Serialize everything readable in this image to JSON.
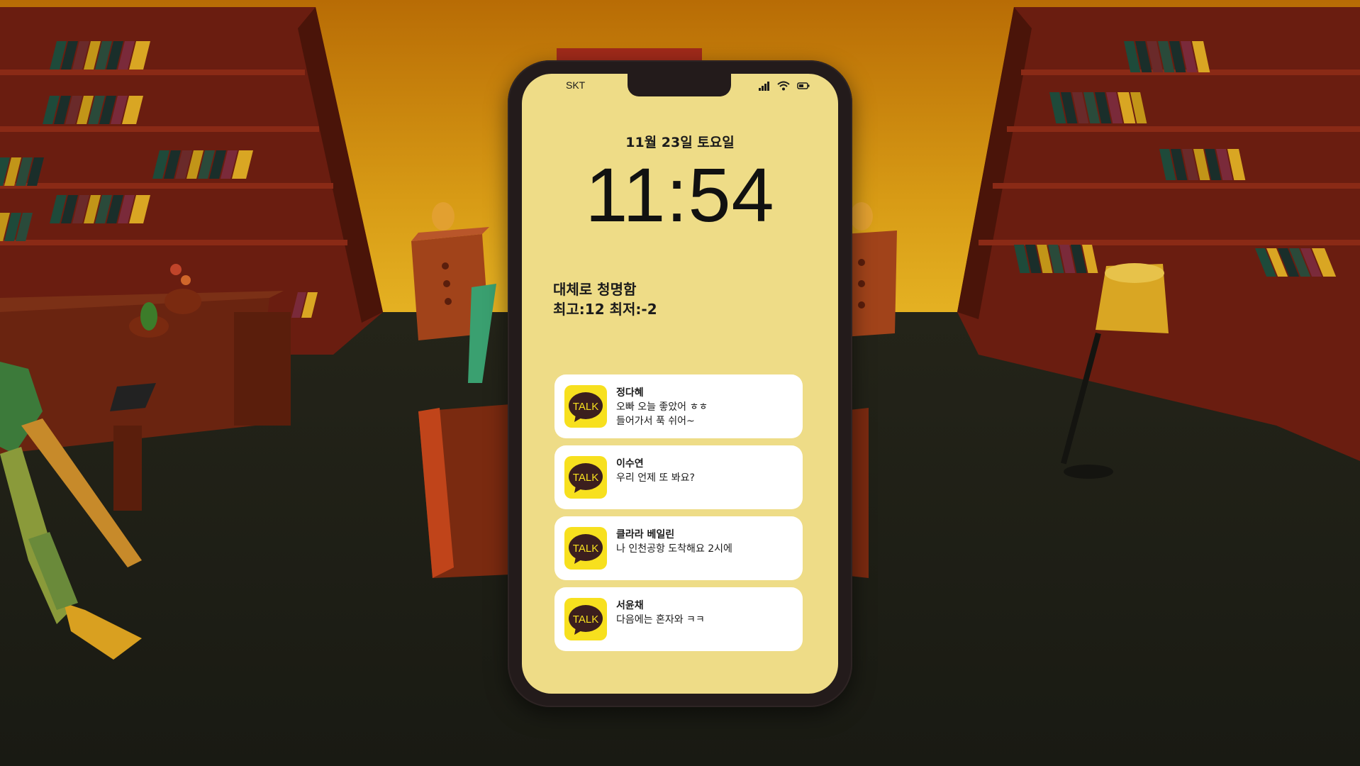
{
  "phone": {
    "carrier": "SKT",
    "date": "11월 23일 토요일",
    "time": "11:54",
    "weather": {
      "condition": "대체로 청명함",
      "temps": "최고:12 최저:-2"
    },
    "icons": [
      "signal-icon",
      "wifi-icon",
      "battery-icon"
    ],
    "notifications": [
      {
        "app_icon": "TALK",
        "sender": "정다혜",
        "lines": [
          "오빠 오늘 좋았어 ㅎㅎ",
          "들어가서 푹 쉬어~"
        ]
      },
      {
        "app_icon": "TALK",
        "sender": "이수연",
        "lines": [
          "우리 언제 또 봐요?"
        ]
      },
      {
        "app_icon": "TALK",
        "sender": "클라라 베일린",
        "lines": [
          "나 인천공항 도착해요 2시에"
        ]
      },
      {
        "app_icon": "TALK",
        "sender": "서윤채",
        "lines": [
          "다음에는 혼자와 ㅋㅋ"
        ]
      }
    ]
  },
  "colors": {
    "screen_bg": "#eedc87",
    "talk_yellow": "#f7e01e",
    "talk_bubble": "#3b1e1e",
    "phone_frame": "#231b1b"
  }
}
